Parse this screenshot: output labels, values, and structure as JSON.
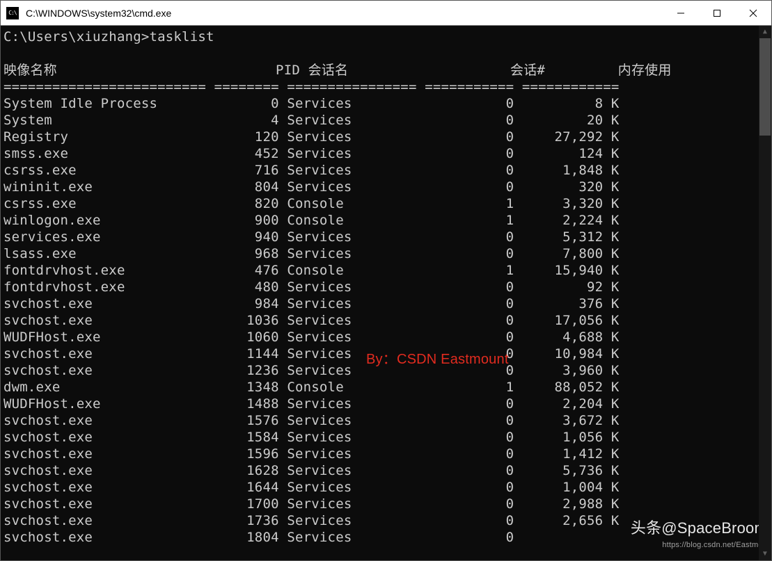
{
  "window": {
    "title": "C:\\WINDOWS\\system32\\cmd.exe",
    "icon_label": "C:\\"
  },
  "prompt": {
    "path": "C:\\Users\\xiuzhang>",
    "command": "tasklist"
  },
  "headers": {
    "image_name": "映像名称",
    "pid": "PID",
    "session_name": "会话名",
    "session_num": "会话#",
    "mem_usage": "内存使用"
  },
  "separator": {
    "c1": "=========================",
    "c2": "========",
    "c3": "================",
    "c4": "===========",
    "c5": "============"
  },
  "processes": [
    {
      "name": "System Idle Process",
      "pid": 0,
      "session_name": "Services",
      "session": 0,
      "mem": "8 K"
    },
    {
      "name": "System",
      "pid": 4,
      "session_name": "Services",
      "session": 0,
      "mem": "20 K"
    },
    {
      "name": "Registry",
      "pid": 120,
      "session_name": "Services",
      "session": 0,
      "mem": "27,292 K"
    },
    {
      "name": "smss.exe",
      "pid": 452,
      "session_name": "Services",
      "session": 0,
      "mem": "124 K"
    },
    {
      "name": "csrss.exe",
      "pid": 716,
      "session_name": "Services",
      "session": 0,
      "mem": "1,848 K"
    },
    {
      "name": "wininit.exe",
      "pid": 804,
      "session_name": "Services",
      "session": 0,
      "mem": "320 K"
    },
    {
      "name": "csrss.exe",
      "pid": 820,
      "session_name": "Console",
      "session": 1,
      "mem": "3,320 K"
    },
    {
      "name": "winlogon.exe",
      "pid": 900,
      "session_name": "Console",
      "session": 1,
      "mem": "2,224 K"
    },
    {
      "name": "services.exe",
      "pid": 940,
      "session_name": "Services",
      "session": 0,
      "mem": "5,312 K"
    },
    {
      "name": "lsass.exe",
      "pid": 968,
      "session_name": "Services",
      "session": 0,
      "mem": "7,800 K"
    },
    {
      "name": "fontdrvhost.exe",
      "pid": 476,
      "session_name": "Console",
      "session": 1,
      "mem": "15,940 K"
    },
    {
      "name": "fontdrvhost.exe",
      "pid": 480,
      "session_name": "Services",
      "session": 0,
      "mem": "92 K"
    },
    {
      "name": "svchost.exe",
      "pid": 984,
      "session_name": "Services",
      "session": 0,
      "mem": "376 K"
    },
    {
      "name": "svchost.exe",
      "pid": 1036,
      "session_name": "Services",
      "session": 0,
      "mem": "17,056 K"
    },
    {
      "name": "WUDFHost.exe",
      "pid": 1060,
      "session_name": "Services",
      "session": 0,
      "mem": "4,688 K"
    },
    {
      "name": "svchost.exe",
      "pid": 1144,
      "session_name": "Services",
      "session": 0,
      "mem": "10,984 K"
    },
    {
      "name": "svchost.exe",
      "pid": 1236,
      "session_name": "Services",
      "session": 0,
      "mem": "3,960 K"
    },
    {
      "name": "dwm.exe",
      "pid": 1348,
      "session_name": "Console",
      "session": 1,
      "mem": "88,052 K"
    },
    {
      "name": "WUDFHost.exe",
      "pid": 1488,
      "session_name": "Services",
      "session": 0,
      "mem": "2,204 K"
    },
    {
      "name": "svchost.exe",
      "pid": 1576,
      "session_name": "Services",
      "session": 0,
      "mem": "3,672 K"
    },
    {
      "name": "svchost.exe",
      "pid": 1584,
      "session_name": "Services",
      "session": 0,
      "mem": "1,056 K"
    },
    {
      "name": "svchost.exe",
      "pid": 1596,
      "session_name": "Services",
      "session": 0,
      "mem": "1,412 K"
    },
    {
      "name": "svchost.exe",
      "pid": 1628,
      "session_name": "Services",
      "session": 0,
      "mem": "5,736 K"
    },
    {
      "name": "svchost.exe",
      "pid": 1644,
      "session_name": "Services",
      "session": 0,
      "mem": "1,004 K"
    },
    {
      "name": "svchost.exe",
      "pid": 1700,
      "session_name": "Services",
      "session": 0,
      "mem": "2,988 K"
    },
    {
      "name": "svchost.exe",
      "pid": 1736,
      "session_name": "Services",
      "session": 0,
      "mem": "2,656 K"
    },
    {
      "name": "svchost.exe",
      "pid": 1804,
      "session_name": "Services",
      "session": 0,
      "mem": ""
    }
  ],
  "watermarks": {
    "center": "By：CSDN Eastmount",
    "bottom_line1": "头条@SpaceBroom",
    "bottom_line2": "https://blog.csdn.net/Eastmou"
  }
}
